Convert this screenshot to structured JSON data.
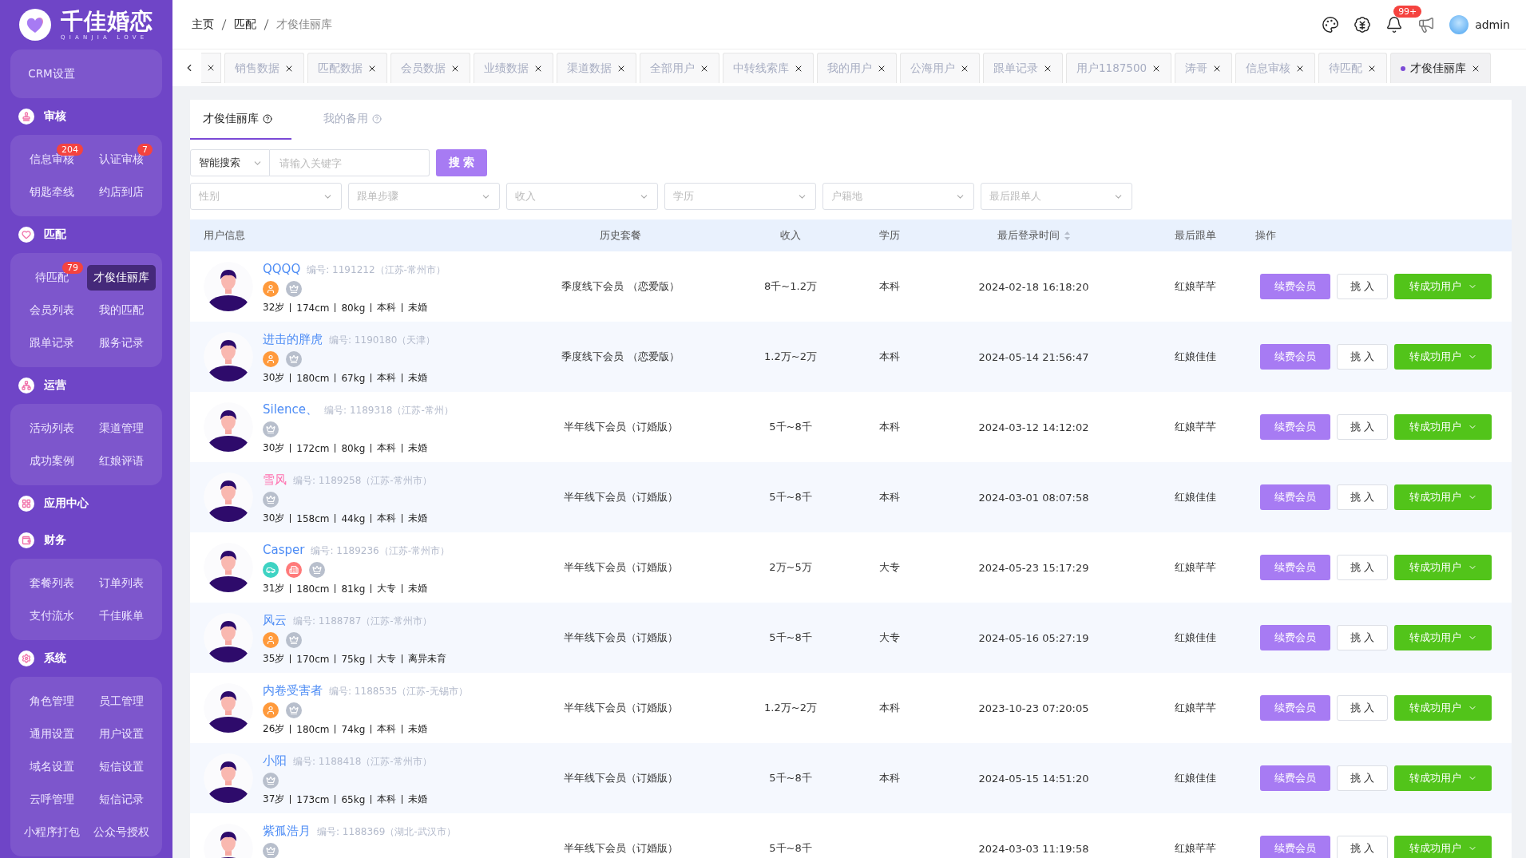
{
  "sidebar": {
    "logo": {
      "title": "千佳婚恋",
      "subtitle": "QIANJIA LOVE"
    },
    "sections": [
      {
        "items": [
          {
            "label": "CRM设置",
            "selected": false
          }
        ]
      },
      {
        "title": "审核",
        "items": [
          {
            "label": "信息审核",
            "badge": "204",
            "selected": false
          },
          {
            "label": "认证审核",
            "badge": "7",
            "selected": false
          },
          {
            "label": "钥匙牵线",
            "selected": false
          },
          {
            "label": "约店到店",
            "selected": false
          }
        ]
      },
      {
        "title": "匹配",
        "items": [
          {
            "label": "待匹配",
            "badge": "79",
            "selected": false
          },
          {
            "label": "才俊佳丽库",
            "selected": true
          },
          {
            "label": "会员列表",
            "selected": false
          },
          {
            "label": "我的匹配",
            "selected": false
          },
          {
            "label": "跟单记录",
            "selected": false
          },
          {
            "label": "服务记录",
            "selected": false
          }
        ]
      },
      {
        "title": "运营",
        "items": [
          {
            "label": "活动列表",
            "selected": false
          },
          {
            "label": "渠道管理",
            "selected": false
          },
          {
            "label": "成功案例",
            "selected": false
          },
          {
            "label": "红娘评语",
            "selected": false
          }
        ]
      },
      {
        "title": "应用中心"
      },
      {
        "title": "财务",
        "items": [
          {
            "label": "套餐列表",
            "selected": false
          },
          {
            "label": "订单列表",
            "selected": false
          },
          {
            "label": "支付流水",
            "selected": false
          },
          {
            "label": "千佳账单",
            "selected": false
          }
        ]
      },
      {
        "title": "系统",
        "items": [
          {
            "label": "角色管理",
            "selected": false
          },
          {
            "label": "员工管理",
            "selected": false
          },
          {
            "label": "通用设置",
            "selected": false
          },
          {
            "label": "用户设置",
            "selected": false
          },
          {
            "label": "域名设置",
            "selected": false
          },
          {
            "label": "短信设置",
            "selected": false
          },
          {
            "label": "云呼管理",
            "selected": false
          },
          {
            "label": "短信记录",
            "selected": false
          },
          {
            "label": "小程序打包",
            "selected": false
          },
          {
            "label": "公众号授权",
            "selected": false
          }
        ]
      }
    ]
  },
  "header": {
    "breadcrumb": [
      "主页",
      "匹配",
      "才俊佳丽库"
    ],
    "notification_badge": "99+",
    "user": "admin"
  },
  "open_tabs": [
    {
      "label": "销售数据",
      "selected": false
    },
    {
      "label": "匹配数据",
      "selected": false
    },
    {
      "label": "会员数据",
      "selected": false
    },
    {
      "label": "业绩数据",
      "selected": false
    },
    {
      "label": "渠道数据",
      "selected": false
    },
    {
      "label": "全部用户",
      "selected": false
    },
    {
      "label": "中转线索库",
      "selected": false
    },
    {
      "label": "我的用户",
      "selected": false
    },
    {
      "label": "公海用户",
      "selected": false
    },
    {
      "label": "跟单记录",
      "selected": false
    },
    {
      "label": "用户1187500",
      "selected": false
    },
    {
      "label": "涛哥",
      "selected": false
    },
    {
      "label": "信息审核",
      "selected": false
    },
    {
      "label": "待匹配",
      "selected": false
    },
    {
      "label": "才俊佳丽库",
      "selected": true
    }
  ],
  "page_tabs": [
    {
      "label": "才俊佳丽库",
      "selected": true
    },
    {
      "label": "我的备用",
      "selected": false
    }
  ],
  "search": {
    "mode": "智能搜索",
    "placeholder": "请输入关键字",
    "button": "搜 索"
  },
  "filters": [
    {
      "placeholder": "性别"
    },
    {
      "placeholder": "跟单步骤"
    },
    {
      "placeholder": "收入"
    },
    {
      "placeholder": "学历"
    },
    {
      "placeholder": "户籍地"
    },
    {
      "placeholder": "最后跟单人"
    }
  ],
  "table": {
    "columns": [
      "用户信息",
      "历史套餐",
      "收入",
      "学历",
      "最后登录时间",
      "最后跟单",
      "操作"
    ],
    "rows": [
      {
        "name": "QQQQ",
        "color": "#4d8cf5",
        "id": "编号: 1191212（江苏-常州市）",
        "badges": [
          {
            "kind": "person"
          },
          {
            "kind": "vip"
          }
        ],
        "stats": [
          "32岁",
          "174cm",
          "80kg",
          "本科",
          "未婚"
        ],
        "package": "季度线下会员 （恋爱版）",
        "income": "8千~1.2万",
        "education": "本科",
        "last_login": "2024-02-18 16:18:20",
        "last_follow": "红娘芊芊",
        "actions": {
          "renew": "续费会员",
          "pick": "挑 入",
          "convert": "转成功用户"
        }
      },
      {
        "name": "进击的胖虎",
        "color": "#4d8cf5",
        "id": "编号: 1190180（天津）",
        "badges": [
          {
            "kind": "person"
          },
          {
            "kind": "vip"
          }
        ],
        "stats": [
          "30岁",
          "180cm",
          "67kg",
          "本科",
          "未婚"
        ],
        "package": "季度线下会员 （恋爱版）",
        "income": "1.2万~2万",
        "education": "本科",
        "last_login": "2024-05-14 21:56:47",
        "last_follow": "红娘佳佳",
        "actions": {
          "renew": "续费会员",
          "pick": "挑 入",
          "convert": "转成功用户"
        }
      },
      {
        "name": "Silence、",
        "color": "#4d8cf5",
        "id": "编号: 1189318（江苏-常州）",
        "badges": [
          {
            "kind": "vip"
          }
        ],
        "stats": [
          "30岁",
          "172cm",
          "80kg",
          "本科",
          "未婚"
        ],
        "package": "半年线下会员（订婚版）",
        "income": "5千~8千",
        "education": "本科",
        "last_login": "2024-03-12 14:12:02",
        "last_follow": "红娘芊芊",
        "actions": {
          "renew": "续费会员",
          "pick": "挑 入",
          "convert": "转成功用户"
        }
      },
      {
        "name": "雪风",
        "color": "#ff6fae",
        "id": "编号: 1189258（江苏-常州市）",
        "badges": [
          {
            "kind": "vip"
          }
        ],
        "stats": [
          "30岁",
          "158cm",
          "44kg",
          "本科",
          "未婚"
        ],
        "package": "半年线下会员（订婚版）",
        "income": "5千~8千",
        "education": "本科",
        "last_login": "2024-03-01 08:07:58",
        "last_follow": "红娘佳佳",
        "actions": {
          "renew": "续费会员",
          "pick": "挑 入",
          "convert": "转成功用户"
        }
      },
      {
        "name": "Casper",
        "color": "#4d8cf5",
        "id": "编号: 1189236（江苏-常州市）",
        "badges": [
          {
            "kind": "car"
          },
          {
            "kind": "house"
          },
          {
            "kind": "vip"
          }
        ],
        "stats": [
          "31岁",
          "180cm",
          "81kg",
          "大专",
          "未婚"
        ],
        "package": "半年线下会员（订婚版）",
        "income": "2万~5万",
        "education": "大专",
        "last_login": "2024-05-23 15:17:29",
        "last_follow": "红娘芊芊",
        "actions": {
          "renew": "续费会员",
          "pick": "挑 入",
          "convert": "转成功用户"
        }
      },
      {
        "name": "风云",
        "color": "#4d8cf5",
        "id": "编号: 1188787（江苏-常州市）",
        "badges": [
          {
            "kind": "person"
          },
          {
            "kind": "vip"
          }
        ],
        "stats": [
          "35岁",
          "170cm",
          "75kg",
          "大专",
          "离异未育"
        ],
        "package": "半年线下会员（订婚版）",
        "income": "5千~8千",
        "education": "大专",
        "last_login": "2024-05-16 05:27:19",
        "last_follow": "红娘佳佳",
        "actions": {
          "renew": "续费会员",
          "pick": "挑 入",
          "convert": "转成功用户"
        }
      },
      {
        "name": "内卷受害者",
        "color": "#4d8cf5",
        "id": "编号: 1188535（江苏-无锡市）",
        "badges": [
          {
            "kind": "person"
          },
          {
            "kind": "vip"
          }
        ],
        "stats": [
          "26岁",
          "180cm",
          "74kg",
          "本科",
          "未婚"
        ],
        "package": "半年线下会员（订婚版）",
        "income": "1.2万~2万",
        "education": "本科",
        "last_login": "2023-10-23 07:20:05",
        "last_follow": "红娘芊芊",
        "actions": {
          "renew": "续费会员",
          "pick": "挑 入",
          "convert": "转成功用户"
        }
      },
      {
        "name": "小阳",
        "color": "#4d8cf5",
        "id": "编号: 1188418（江苏-常州市）",
        "badges": [
          {
            "kind": "vip"
          }
        ],
        "stats": [
          "37岁",
          "173cm",
          "65kg",
          "本科",
          "未婚"
        ],
        "package": "半年线下会员（订婚版）",
        "income": "5千~8千",
        "education": "本科",
        "last_login": "2024-05-15 14:51:20",
        "last_follow": "红娘佳佳",
        "actions": {
          "renew": "续费会员",
          "pick": "挑 入",
          "convert": "转成功用户"
        }
      },
      {
        "name": "紫孤浩月",
        "color": "#4d8cf5",
        "id": "编号: 1188369（湖北-武汉市）",
        "badges": [
          {
            "kind": "vip"
          }
        ],
        "package": "半年线下会员（订婚版）",
        "income": "5千~8千",
        "last_login": "2024-03-03 11:19:58",
        "last_follow": "红娘芊芊",
        "actions": {
          "renew": "续费会员",
          "pick": "挑 入",
          "convert": "转成功用户"
        }
      }
    ]
  }
}
